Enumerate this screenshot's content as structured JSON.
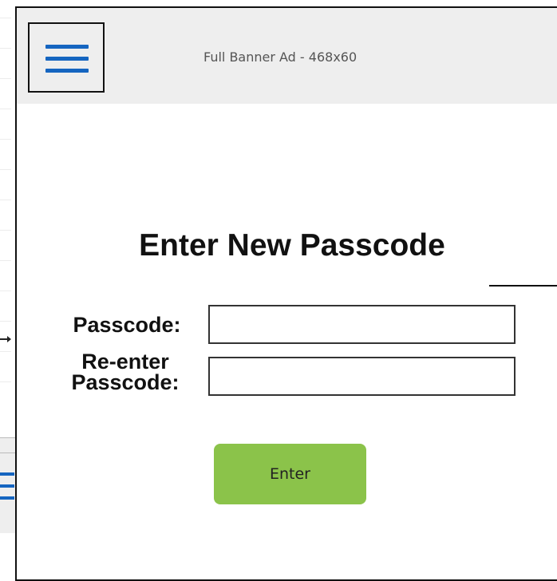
{
  "header": {
    "banner_ad_text": "Full Banner Ad - 468x60",
    "menu_icon": "hamburger-menu-icon"
  },
  "form": {
    "title": "Enter New Passcode",
    "passcode_label": "Passcode:",
    "reenter_label_line1": "Re-enter",
    "reenter_label_line2": "Passcode:",
    "passcode_value": "",
    "reenter_value": "",
    "submit_label": "Enter"
  },
  "colors": {
    "accent_blue": "#1565c0",
    "button_green": "#8bc34a",
    "header_gray": "#eeeeee"
  }
}
